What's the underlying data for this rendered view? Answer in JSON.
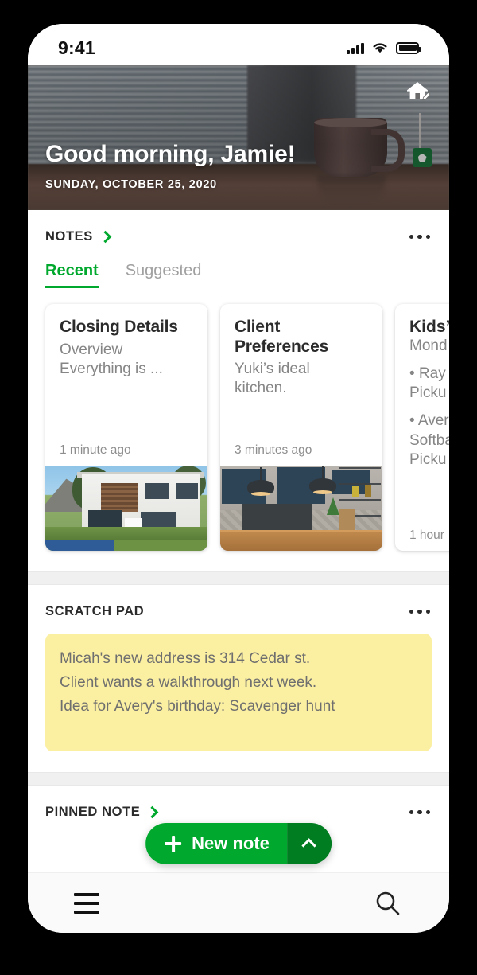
{
  "status_bar": {
    "time": "9:41",
    "signal_icon": "cellular-signal-icon",
    "wifi_icon": "wifi-icon",
    "battery_icon": "battery-full-icon"
  },
  "header": {
    "greeting": "Good morning, Jamie!",
    "date": "SUNDAY, OCTOBER 25, 2020",
    "home_edit_icon": "home-edit-icon"
  },
  "notes_section": {
    "title": "NOTES",
    "chevron_icon": "chevron-right-icon",
    "overflow_icon": "overflow-menu-icon",
    "tabs": [
      {
        "label": "Recent",
        "active": true
      },
      {
        "label": "Suggested",
        "active": false
      }
    ],
    "cards": [
      {
        "title": "Closing Details",
        "line1": "Overview",
        "line2": "Everything is ...",
        "time": "1 minute ago",
        "image": "modern-house-photo"
      },
      {
        "title": "Client Preferences",
        "line1": "Yuki’s ideal",
        "line2": "kitchen.",
        "time": "3 minutes ago",
        "image": "blue-kitchen-photo"
      },
      {
        "title": "Kids’",
        "line1": "Mond",
        "line2": "• Ray -",
        "line3": "Picku",
        "line4": "• Aver",
        "line5": "Softba",
        "line6": "Picku",
        "time": "1 hour"
      }
    ]
  },
  "scratch_pad": {
    "title": "SCRATCH PAD",
    "overflow_icon": "overflow-menu-icon",
    "lines": [
      "Micah's new address is 314 Cedar st.",
      "Client wants a walkthrough next week.",
      "Idea for Avery's birthday: Scavenger hunt"
    ]
  },
  "pinned_note": {
    "title": "PINNED NOTE",
    "chevron_icon": "chevron-right-icon",
    "overflow_icon": "overflow-menu-icon"
  },
  "fab": {
    "label": "New note",
    "plus_icon": "plus-icon",
    "caret_icon": "chevron-up-icon"
  },
  "nav_bar": {
    "menu_icon": "hamburger-menu-icon",
    "search_icon": "search-icon"
  },
  "colors": {
    "accent_green": "#00a82d",
    "accent_green_dark": "#007d20",
    "scratch_yellow": "#fbefa2",
    "divider_gray": "#f0f0f0"
  }
}
